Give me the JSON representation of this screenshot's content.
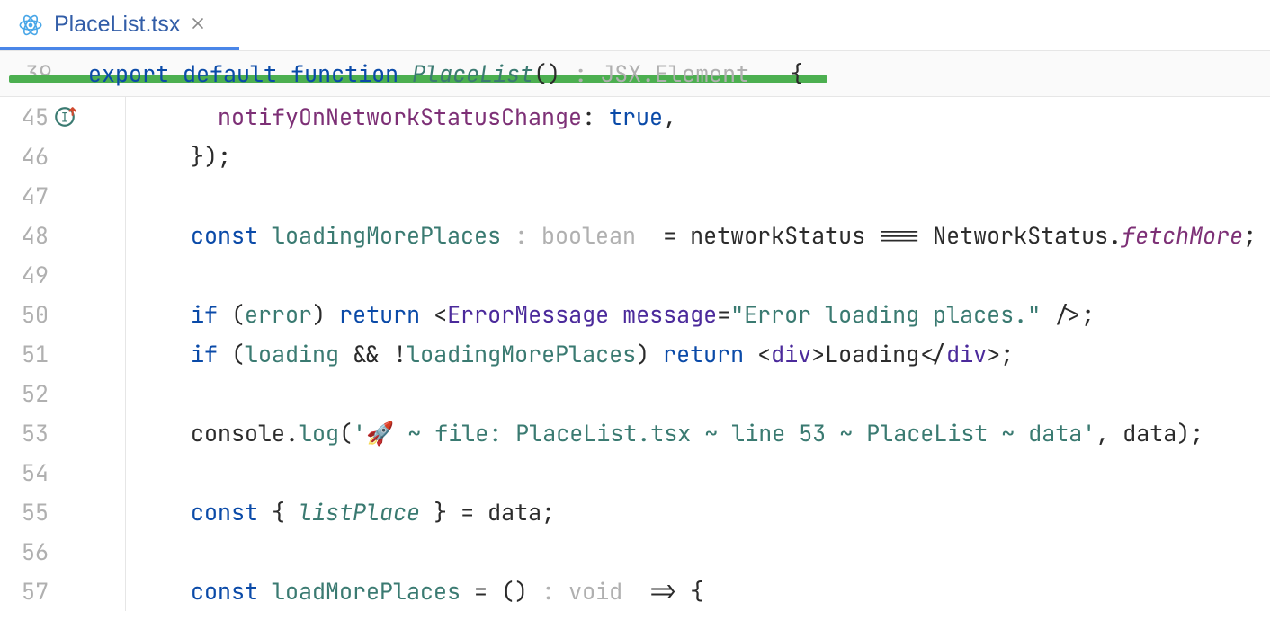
{
  "tab": {
    "file_name": "PlaceList.tsx",
    "icon": "react-file-icon",
    "close_icon": "close-icon"
  },
  "sticky_header": {
    "line_number": "39",
    "tokens": {
      "export": "export",
      "default": "default",
      "function": "function",
      "fn_name": "PlaceList",
      "paren": "()",
      "hint_colon": " : ",
      "hint_type": "JSX.Element",
      "brace": " {"
    }
  },
  "lines": [
    {
      "n": "45",
      "gutter_extra_icon": "usage-up-icon",
      "indent": "      ",
      "tokens": [
        {
          "cls": "purple",
          "t": "notifyOnNetworkStatusChange"
        },
        {
          "cls": "default",
          "t": ": "
        },
        {
          "cls": "lit",
          "t": "true"
        },
        {
          "cls": "default",
          "t": ","
        }
      ]
    },
    {
      "n": "46",
      "indent": "    ",
      "tokens": [
        {
          "cls": "default",
          "t": "});"
        }
      ]
    },
    {
      "n": "47",
      "indent": "",
      "tokens": []
    },
    {
      "n": "48",
      "indent": "    ",
      "tokens": [
        {
          "cls": "kw",
          "t": "const "
        },
        {
          "cls": "id-decl",
          "t": "loadingMorePlaces"
        },
        {
          "cls": "hint",
          "t": " : boolean "
        },
        {
          "cls": "default",
          "t": " = networkStatus === NetworkStatus."
        },
        {
          "cls": "purple-ital",
          "t": "fetchMore"
        },
        {
          "cls": "default",
          "t": ";"
        }
      ]
    },
    {
      "n": "49",
      "indent": "",
      "tokens": []
    },
    {
      "n": "50",
      "indent": "    ",
      "tokens": [
        {
          "cls": "kw",
          "t": "if"
        },
        {
          "cls": "default",
          "t": " ("
        },
        {
          "cls": "id-decl",
          "t": "error"
        },
        {
          "cls": "default",
          "t": ") "
        },
        {
          "cls": "kw",
          "t": "return"
        },
        {
          "cls": "default",
          "t": " <"
        },
        {
          "cls": "tagname",
          "t": "ErrorMessage "
        },
        {
          "cls": "attr",
          "t": "message"
        },
        {
          "cls": "default",
          "t": "="
        },
        {
          "cls": "str",
          "t": "\"Error loading places.\""
        },
        {
          "cls": "default",
          "t": " />;"
        }
      ]
    },
    {
      "n": "51",
      "indent": "    ",
      "tokens": [
        {
          "cls": "kw",
          "t": "if"
        },
        {
          "cls": "default",
          "t": " ("
        },
        {
          "cls": "id-decl",
          "t": "loading"
        },
        {
          "cls": "default",
          "t": " && !"
        },
        {
          "cls": "id-decl",
          "t": "loadingMorePlaces"
        },
        {
          "cls": "default",
          "t": ") "
        },
        {
          "cls": "kw",
          "t": "return"
        },
        {
          "cls": "default",
          "t": " <"
        },
        {
          "cls": "tagname",
          "t": "div"
        },
        {
          "cls": "default",
          "t": ">Loading</"
        },
        {
          "cls": "tagname",
          "t": "div"
        },
        {
          "cls": "default",
          "t": ">;"
        }
      ]
    },
    {
      "n": "52",
      "indent": "",
      "tokens": []
    },
    {
      "n": "53",
      "indent": "    ",
      "tokens": [
        {
          "cls": "default",
          "t": "console."
        },
        {
          "cls": "id-decl",
          "t": "log"
        },
        {
          "cls": "default",
          "t": "("
        },
        {
          "cls": "str",
          "t": "'🚀 ~ file: PlaceList.tsx ~ line 53 ~ PlaceList ~ data'"
        },
        {
          "cls": "default",
          "t": ", data);"
        }
      ]
    },
    {
      "n": "54",
      "indent": "",
      "tokens": []
    },
    {
      "n": "55",
      "indent": "    ",
      "tokens": [
        {
          "cls": "kw",
          "t": "const"
        },
        {
          "cls": "default",
          "t": " { "
        },
        {
          "cls": "id-italic",
          "t": "listPlace"
        },
        {
          "cls": "default",
          "t": " } = data;"
        }
      ]
    },
    {
      "n": "56",
      "indent": "",
      "tokens": []
    },
    {
      "n": "57",
      "indent": "    ",
      "tokens": [
        {
          "cls": "kw",
          "t": "const "
        },
        {
          "cls": "id-decl",
          "t": "loadMorePlaces"
        },
        {
          "cls": "default",
          "t": " = () "
        },
        {
          "cls": "hint",
          "t": ": void "
        },
        {
          "cls": "default",
          "t": " => {"
        }
      ]
    }
  ]
}
